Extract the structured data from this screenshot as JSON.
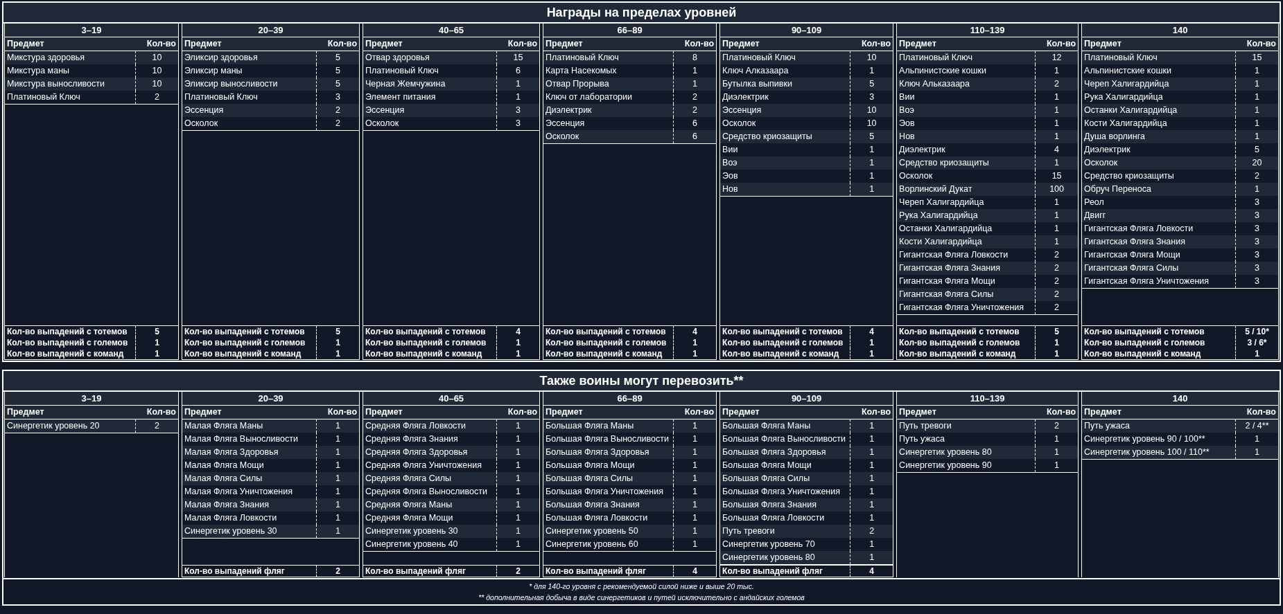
{
  "sections": [
    {
      "title": "Награды на пределах уровней",
      "groups": [
        {
          "range": "3–19",
          "columns": [
            "Предмет",
            "Кол-во"
          ],
          "items": [
            {
              "name": "Микстура здоровья",
              "count": "10"
            },
            {
              "name": "Микстура маны",
              "count": "10"
            },
            {
              "name": "Микстура выносливости",
              "count": "10"
            },
            {
              "name": "Платиновый Ключ",
              "count": "2"
            }
          ],
          "summary": [
            {
              "label": "Кол-во выпадений с тотемов",
              "value": "5"
            },
            {
              "label": "Кол-во выпадений с големов",
              "value": "1"
            },
            {
              "label": "Кол-во выпадений с команд",
              "value": "1"
            }
          ]
        },
        {
          "range": "20–39",
          "columns": [
            "Предмет",
            "Кол-во"
          ],
          "items": [
            {
              "name": "Эликсир здоровья",
              "count": "5"
            },
            {
              "name": "Эликсир маны",
              "count": "5"
            },
            {
              "name": "Эликсир выносливости",
              "count": "5"
            },
            {
              "name": "Платиновый Ключ",
              "count": "3"
            },
            {
              "name": "Эссенция",
              "count": "2"
            },
            {
              "name": "Осколок",
              "count": "2"
            }
          ],
          "summary": [
            {
              "label": "Кол-во выпадений с тотемов",
              "value": "5"
            },
            {
              "label": "Кол-во выпадений с големов",
              "value": "1"
            },
            {
              "label": "Кол-во выпадений с команд",
              "value": "1"
            }
          ]
        },
        {
          "range": "40–65",
          "columns": [
            "Предмет",
            "Кол-во"
          ],
          "items": [
            {
              "name": "Отвар здоровья",
              "count": "15"
            },
            {
              "name": "Платиновый Ключ",
              "count": "6"
            },
            {
              "name": "Черная Жемчужина",
              "count": "1"
            },
            {
              "name": "Элемент питания",
              "count": "1"
            },
            {
              "name": "Эссенция",
              "count": "3"
            },
            {
              "name": "Осколок",
              "count": "3"
            }
          ],
          "summary": [
            {
              "label": "Кол-во выпадений с тотемов",
              "value": "4"
            },
            {
              "label": "Кол-во выпадений с големов",
              "value": "1"
            },
            {
              "label": "Кол-во выпадений с команд",
              "value": "1"
            }
          ]
        },
        {
          "range": "66–89",
          "columns": [
            "Предмет",
            "Кол-во"
          ],
          "items": [
            {
              "name": "Платиновый Ключ",
              "count": "8"
            },
            {
              "name": "Карта Насекомых",
              "count": "1"
            },
            {
              "name": "Отвар Прорыва",
              "count": "1"
            },
            {
              "name": "Ключ от лаборатории",
              "count": "2"
            },
            {
              "name": "Диэлектрик",
              "count": "2"
            },
            {
              "name": "Эссенция",
              "count": "6"
            },
            {
              "name": "Осколок",
              "count": "6"
            }
          ],
          "summary": [
            {
              "label": "Кол-во выпадений с тотемов",
              "value": "4"
            },
            {
              "label": "Кол-во выпадений с големов",
              "value": "1"
            },
            {
              "label": "Кол-во выпадений с команд",
              "value": "1"
            }
          ]
        },
        {
          "range": "90–109",
          "columns": [
            "Предмет",
            "Кол-во"
          ],
          "items": [
            {
              "name": "Платиновый Ключ",
              "count": "10"
            },
            {
              "name": "Ключ Алказаара",
              "count": "1"
            },
            {
              "name": "Бутылка выпивки",
              "count": "5"
            },
            {
              "name": "Диэлектрик",
              "count": "3"
            },
            {
              "name": "Эссенция",
              "count": "10"
            },
            {
              "name": "Осколок",
              "count": "10"
            },
            {
              "name": "Средство криозащиты",
              "count": "5"
            },
            {
              "name": "Вии",
              "count": "1"
            },
            {
              "name": "Воэ",
              "count": "1"
            },
            {
              "name": "Эов",
              "count": "1"
            },
            {
              "name": "Нов",
              "count": "1"
            }
          ],
          "summary": [
            {
              "label": "Кол-во выпадений с тотемов",
              "value": "4"
            },
            {
              "label": "Кол-во выпадений с големов",
              "value": "1"
            },
            {
              "label": "Кол-во выпадений с команд",
              "value": "1"
            }
          ]
        },
        {
          "range": "110–139",
          "columns": [
            "Предмет",
            "Кол-во"
          ],
          "items": [
            {
              "name": "Платиновый Ключ",
              "count": "12"
            },
            {
              "name": "Альпинистские кошки",
              "count": "1"
            },
            {
              "name": "Ключ Альказаара",
              "count": "2"
            },
            {
              "name": "Вии",
              "count": "1"
            },
            {
              "name": "Воэ",
              "count": "1"
            },
            {
              "name": "Эов",
              "count": "1"
            },
            {
              "name": "Нов",
              "count": "1"
            },
            {
              "name": "Диэлектрик",
              "count": "4"
            },
            {
              "name": "Средство криозащиты",
              "count": "1"
            },
            {
              "name": "Осколок",
              "count": "15"
            },
            {
              "name": "Ворлинский Дукат",
              "count": "100"
            },
            {
              "name": "Череп Халигардийца",
              "count": "1"
            },
            {
              "name": "Рука Халигардийца",
              "count": "1"
            },
            {
              "name": "Останки Халигардийца",
              "count": "1"
            },
            {
              "name": "Кости Халигардийца",
              "count": "1"
            },
            {
              "name": "Гигантская Фляга Ловкости",
              "count": "2"
            },
            {
              "name": "Гигантская Фляга Знания",
              "count": "2"
            },
            {
              "name": "Гигантская Фляга Мощи",
              "count": "2"
            },
            {
              "name": "Гигантская Фляга Силы",
              "count": "2"
            },
            {
              "name": "Гигантская Фляга Уничтожения",
              "count": "2"
            }
          ],
          "summary": [
            {
              "label": "Кол-во выпадений с тотемов",
              "value": "5"
            },
            {
              "label": "Кол-во выпадений с големов",
              "value": "1"
            },
            {
              "label": "Кол-во выпадений с команд",
              "value": "1"
            }
          ]
        },
        {
          "range": "140",
          "columns": [
            "Предмет",
            "Кол-во"
          ],
          "items": [
            {
              "name": "Платиновый Ключ",
              "count": "15"
            },
            {
              "name": "Альпинистские кошки",
              "count": "1"
            },
            {
              "name": "Череп Халигардийца",
              "count": "1"
            },
            {
              "name": "Рука Халигардийца",
              "count": "1"
            },
            {
              "name": "Останки Халигардийца",
              "count": "1"
            },
            {
              "name": "Кости Халигардийца",
              "count": "1"
            },
            {
              "name": "Душа ворлинга",
              "count": "1"
            },
            {
              "name": "Диэлектрик",
              "count": "5"
            },
            {
              "name": "Осколок",
              "count": "20"
            },
            {
              "name": "Средство криозащиты",
              "count": "2"
            },
            {
              "name": "Обруч Переноса",
              "count": "1"
            },
            {
              "name": "Реол",
              "count": "3"
            },
            {
              "name": "Двигг",
              "count": "3"
            },
            {
              "name": "Гигантская Фляга Ловкости",
              "count": "3"
            },
            {
              "name": "Гигантская Фляга Знания",
              "count": "3"
            },
            {
              "name": "Гигантская Фляга Мощи",
              "count": "3"
            },
            {
              "name": "Гигантская Фляга Силы",
              "count": "3"
            },
            {
              "name": "Гигантская Фляга Уничтожения",
              "count": "3"
            }
          ],
          "summary": [
            {
              "label": "Кол-во выпадений с тотемов",
              "value": "5 / 10*"
            },
            {
              "label": "Кол-во выпадений с големов",
              "value": "3 / 6*"
            },
            {
              "label": "Кол-во выпадений с команд",
              "value": "1"
            }
          ]
        }
      ]
    },
    {
      "title": "Также воины могут перевозить**",
      "groups": [
        {
          "range": "3–19",
          "columns": [
            "Предмет",
            "Кол-во"
          ],
          "items": [
            {
              "name": "Синергетик уровень 20",
              "count": "2"
            }
          ]
        },
        {
          "range": "20–39",
          "columns": [
            "Предмет",
            "Кол-во"
          ],
          "items": [
            {
              "name": "Малая Фляга Маны",
              "count": "1"
            },
            {
              "name": "Малая Фляга Выносливости",
              "count": "1"
            },
            {
              "name": "Малая Фляга Здоровья",
              "count": "1"
            },
            {
              "name": "Малая Фляга Мощи",
              "count": "1"
            },
            {
              "name": "Малая Фляга Силы",
              "count": "1"
            },
            {
              "name": "Малая Фляга Уничтожения",
              "count": "1"
            },
            {
              "name": "Малая Фляга Знания",
              "count": "1"
            },
            {
              "name": "Малая Фляга Ловкости",
              "count": "1"
            },
            {
              "name": "Синергетик уровень 30",
              "count": "1"
            }
          ],
          "summary": [
            {
              "label": "Кол-во выпадений фляг",
              "value": "2"
            }
          ]
        },
        {
          "range": "40–65",
          "columns": [
            "Предмет",
            "Кол-во"
          ],
          "items": [
            {
              "name": "Средняя Фляга Ловкости",
              "count": "1"
            },
            {
              "name": "Средняя Фляга Знания",
              "count": "1"
            },
            {
              "name": "Средняя Фляга Здоровья",
              "count": "1"
            },
            {
              "name": "Средняя Фляга Уничтожения",
              "count": "1"
            },
            {
              "name": "Средняя Фляга Силы",
              "count": "1"
            },
            {
              "name": "Средняя Фляга Выносливости",
              "count": "1"
            },
            {
              "name": "Средняя Фляга Маны",
              "count": "1"
            },
            {
              "name": "Средняя Фляга Мощи",
              "count": "1"
            },
            {
              "name": "Синергетик уровень 30",
              "count": "1"
            },
            {
              "name": "Синергетик уровень 40",
              "count": "1"
            }
          ],
          "summary": [
            {
              "label": "Кол-во выпадений фляг",
              "value": "2"
            }
          ]
        },
        {
          "range": "66–89",
          "columns": [
            "Предмет",
            "Кол-во"
          ],
          "items": [
            {
              "name": "Большая Фляга Маны",
              "count": "1"
            },
            {
              "name": "Большая Фляга Выносливости",
              "count": "1"
            },
            {
              "name": "Большая Фляга Здоровья",
              "count": "1"
            },
            {
              "name": "Большая Фляга Мощи",
              "count": "1"
            },
            {
              "name": "Большая Фляга Силы",
              "count": "1"
            },
            {
              "name": "Большая Фляга Уничтожения",
              "count": "1"
            },
            {
              "name": "Большая Фляга Знания",
              "count": "1"
            },
            {
              "name": "Большая Фляга Ловкости",
              "count": "1"
            },
            {
              "name": "Синергетик уровень 50",
              "count": "1"
            },
            {
              "name": "Синергетик уровень 60",
              "count": "1"
            }
          ],
          "summary": [
            {
              "label": "Кол-во выпадений фляг",
              "value": "4"
            }
          ]
        },
        {
          "range": "90–109",
          "columns": [
            "Предмет",
            "Кол-во"
          ],
          "items": [
            {
              "name": "Большая Фляга Маны",
              "count": "1"
            },
            {
              "name": "Большая Фляга Выносливости",
              "count": "1"
            },
            {
              "name": "Большая Фляга Здоровья",
              "count": "1"
            },
            {
              "name": "Большая Фляга Мощи",
              "count": "1"
            },
            {
              "name": "Большая Фляга Силы",
              "count": "1"
            },
            {
              "name": "Большая Фляга Уничтожения",
              "count": "1"
            },
            {
              "name": "Большая Фляга Знания",
              "count": "1"
            },
            {
              "name": "Большая Фляга Ловкости",
              "count": "1"
            },
            {
              "name": "Путь тревоги",
              "count": "2"
            },
            {
              "name": "Синергетик уровень 70",
              "count": "1"
            },
            {
              "name": "Синергетик уровень 80",
              "count": "1"
            }
          ],
          "summary": [
            {
              "label": "Кол-во выпадений фляг",
              "value": "4"
            }
          ]
        },
        {
          "range": "110–139",
          "columns": [
            "Предмет",
            "Кол-во"
          ],
          "items": [
            {
              "name": "Путь тревоги",
              "count": "2"
            },
            {
              "name": "Путь ужаса",
              "count": "1"
            },
            {
              "name": "Синергетик уровень 80",
              "count": "1"
            },
            {
              "name": "Синергетик уровень 90",
              "count": "1"
            }
          ]
        },
        {
          "range": "140",
          "columns": [
            "Предмет",
            "Кол-во"
          ],
          "items": [
            {
              "name": "Путь ужаса",
              "count": "2 / 4**"
            },
            {
              "name": "Синергетик уровень 90 / 100**",
              "count": "1"
            },
            {
              "name": "Синергетик уровень 100 / 110**",
              "count": "1"
            }
          ]
        }
      ]
    }
  ],
  "footnotes": [
    "* для 140-го уровня с рекомендуемой силой ниже и выше 20 тыс.",
    "** дополнительная добыча в виде синергетиков и путей исключительно с андайских големов"
  ]
}
